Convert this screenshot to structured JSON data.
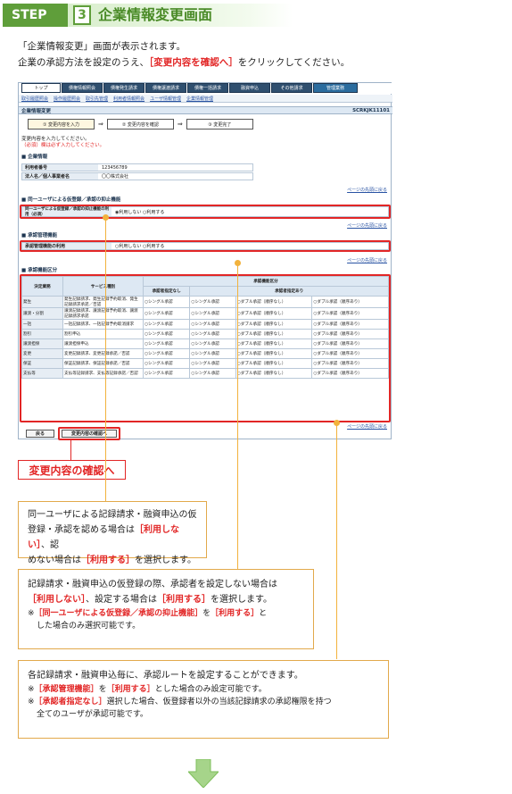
{
  "header": {
    "step_label": "STEP",
    "step_number": "3",
    "title": "企業情報変更画面"
  },
  "intro": {
    "line1": "「企業情報変更」画面が表示されます。",
    "line2_a": "企業の承認方法を設定のうえ、",
    "line2_b": "［変更内容を確認へ］",
    "line2_c": "をクリックしてください。"
  },
  "screen": {
    "tabs": [
      "トップ",
      "債権情報照会",
      "債権発生請求",
      "債権譲渡請求",
      "債権一括請求",
      "融資申込",
      "その他請求",
      "管理業務"
    ],
    "subnav": [
      "取引履歴照会",
      "操作履歴照会",
      "取引先管理",
      "利用者情報照会",
      "ユーザ情報管理",
      "企業情報管理"
    ],
    "page_title": "企業情報変更",
    "screen_id": "SCRKJK11101",
    "steps": [
      "① 変更内容を入力",
      "② 変更内容を確認",
      "③ 変更完了"
    ],
    "message1": "変更内容を入力してください。",
    "message2": "（必須）欄は必ず入力してください。",
    "sec_company": "企業情報",
    "user_no_label": "利用者番号",
    "user_no_value": "123456789",
    "corp_name_label": "法人名／個人事業者名",
    "corp_name_value": "〇〇株式会社",
    "page_top": "ページの先頭に戻る",
    "sec_suppress": "同一ユーザによる仮登録／承認の抑止機能",
    "suppress_label": "同一ユーザによる仮登録／承認の抑止機能の利用（必須）",
    "suppress_options": "◉利用しない ○利用する",
    "sec_approval": "承認管理機能",
    "approval_label": "承認管理機能の利用",
    "approval_options": "○利用しない ○利用する",
    "sec_category": "承認機能区分",
    "grid_headers": {
      "biz": "決定業務",
      "service": "サービス種別",
      "group": "承認機能区分",
      "none": "承認者指定なし",
      "yes": "承認者指定あり"
    },
    "grid_rows": [
      {
        "biz": "発生",
        "service": "発生記録請求、発生記録予約取消、発生記録請求承諾／否認"
      },
      {
        "biz": "譲渡・分割",
        "service": "譲渡記録請求、譲渡記録予約取消、譲渡記録請求承諾"
      },
      {
        "biz": "一括",
        "service": "一括記録請求、一括記録予約取消請求"
      },
      {
        "biz": "割引",
        "service": "割引申込"
      },
      {
        "biz": "譲渡担保",
        "service": "譲渡担保申込"
      },
      {
        "biz": "変更",
        "service": "変更記録請求、変更記録承諾／否認"
      },
      {
        "biz": "保証",
        "service": "保証記録請求、保証記録承諾／否認"
      },
      {
        "biz": "支払等",
        "service": "支払等記録請求、支払等記録承諾／否認"
      }
    ],
    "opt_single": "○シングル承認",
    "opt_double_unordered": "○ダブル承認（順序なし）",
    "opt_double_ordered": "○ダブル承認（順序あり）",
    "back_button": "戻る",
    "confirm_button": "変更内容の確認へ"
  },
  "cta": "変更内容の確認へ",
  "callout1": {
    "text1": "同一ユーザによる記録請求・融資申込の仮",
    "text2a": "登録・承認を認める場合は",
    "text2b": "［利用しない］",
    "text2c": "、認",
    "text3a": "めない場合は",
    "text3b": "［利用する］",
    "text3c": "を選択します。"
  },
  "callout2": {
    "text1": "記録請求・融資申込の仮登録の際、承認者を設定しない場合は",
    "text2a": "［利用しない］",
    "text2b": "、設定する場合は",
    "text2c": "［利用する］",
    "text2d": "を選択します。",
    "note_a": "※",
    "note_b": "［同一ユーザによる仮登録／承認の抑止機能］",
    "note_c": "を",
    "note_d": "［利用する］",
    "note_e": "と",
    "note2": "した場合のみ選択可能です。"
  },
  "callout3": {
    "text1": "各記録請求・融資申込毎に、承認ルートを設定することができます。",
    "n1a": "※",
    "n1b": "［承認管理機能］",
    "n1c": "を",
    "n1d": "［利用する］",
    "n1e": "とした場合のみ設定可能です。",
    "n2a": "※",
    "n2b": "［承認者指定なし］",
    "n2c": "選択した場合、仮登録者以外の当該記録請求の承認権限を持つ",
    "n2d": "全てのユーザが承認可能です。"
  },
  "colors": {
    "brand_green": "#5f9e3a",
    "accent_red": "#e22626",
    "callout_orange": "#f2b23c"
  }
}
